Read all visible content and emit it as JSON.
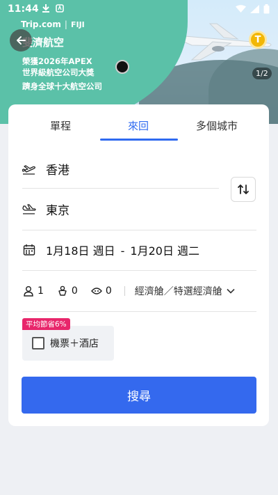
{
  "status_bar": {
    "time": "11:44",
    "icons_left": [
      "download-icon",
      "app-notification-icon"
    ],
    "icons_right": [
      "wifi-icon",
      "signal-icon",
      "battery-icon"
    ]
  },
  "banner": {
    "brand": "Trip.com",
    "brand_separator": "|",
    "partner_logo_text": "FIJI",
    "headline": "斐濟航空",
    "subline_1": "榮獲2026年APEX",
    "subline_2": "世界級航空公司大獎",
    "subline_3": "躋身全球十大航空公司",
    "coin_label": "T",
    "page_indicator": "1/2"
  },
  "tabs": [
    {
      "label": "單程",
      "active": false
    },
    {
      "label": "來回",
      "active": true
    },
    {
      "label": "多個城市",
      "active": false
    }
  ],
  "route": {
    "from": "香港",
    "to": "東京"
  },
  "dates": {
    "depart": "1月18日 週日",
    "separator": "-",
    "return": "1月20日 週二"
  },
  "passengers": {
    "adults": "1",
    "children": "0",
    "infants": "0",
    "cabin": "經濟艙／特選經濟艙"
  },
  "bundle": {
    "promo": "平均節省6%",
    "label": "機票＋酒店",
    "checked": false
  },
  "search_label": "搜尋",
  "colors": {
    "accent": "#2f6af0",
    "search_button": "#3469ee",
    "promo": "#e8266b",
    "banner_teal": "#5bc1a8",
    "coin": "#f2b705"
  }
}
